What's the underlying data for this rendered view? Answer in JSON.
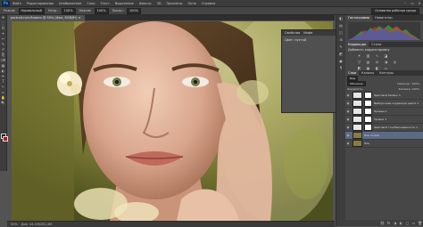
{
  "menu": {
    "logo": "Ps",
    "items": [
      "Файл",
      "Редактирование",
      "Изображение",
      "Слои",
      "Текст",
      "Выделение",
      "Фильтр",
      "3D",
      "Просмотр",
      "Окно",
      "Справка"
    ],
    "win_controls": [
      "–",
      "▭",
      "✕"
    ]
  },
  "options": {
    "items": [
      "Режим:",
      "Нормальный",
      "Непр.:",
      "100%",
      "Нажим:",
      "100%",
      "Прозр.:",
      "100%"
    ],
    "workspace": "Основная рабочая среда"
  },
  "tools": [
    "✣",
    "⬚",
    "ʘ",
    "⌖",
    "✂",
    "✎",
    "✐",
    "⎘",
    "⌫",
    "▦",
    "◐",
    "✒",
    "T",
    "↖",
    "▭",
    "✋",
    "🔍"
  ],
  "document": {
    "tab": "portrait-hair-flowers @ 50% (Фон, RGB/8*) ×",
    "zoom": "50%",
    "doc_info": "Док: 44,1M/262,4M"
  },
  "float_panel": {
    "tabs": [
      "Свойства",
      "Инфо"
    ],
    "body_text": "Цвет: пустой"
  },
  "dock_icons": [
    "◧",
    "▤",
    "◫",
    "⊞",
    "✎",
    "◩",
    "▣",
    "¶"
  ],
  "panels": {
    "top_tabs": [
      "Гистограмма",
      "Навигатор"
    ],
    "mid_tabs": [
      "Коррекция",
      "Стили"
    ],
    "adj_title": "Добавить корректировку",
    "layer_tabs": [
      "Слои",
      "Каналы",
      "Контуры"
    ],
    "kind": "Вид",
    "blend": "Обычные",
    "opacity_label": "Непрозр.: 100%",
    "lock_label": "Закрепить:",
    "fill_label": "Заливка: 100%",
    "layers": [
      {
        "name": "Цветовой баланс 1",
        "selected": false
      },
      {
        "name": "Выборочная коррекция цвета 1",
        "selected": false
      },
      {
        "name": "Кривые 1",
        "selected": false
      },
      {
        "name": "Уровни 1",
        "selected": false
      },
      {
        "name": "Цветовой тон/Насыщенность 1",
        "selected": false
      },
      {
        "name": "Фон копия",
        "selected": true
      },
      {
        "name": "Фон",
        "selected": false
      }
    ],
    "footer_icons": [
      "⛓",
      "fx",
      "◑",
      "◐",
      "▢",
      "▭",
      "🗑"
    ]
  }
}
